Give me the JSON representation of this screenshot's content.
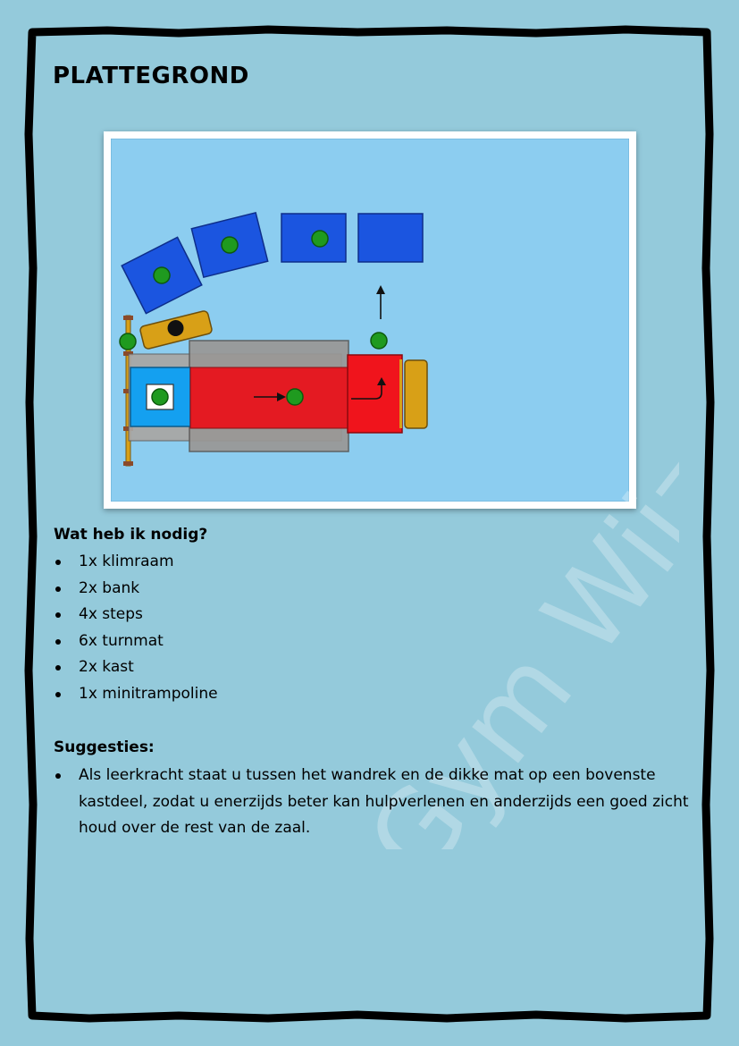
{
  "page": {
    "title": "PLATTEGROND",
    "watermark": "Gym Wijzer ©"
  },
  "needs": {
    "heading": "Wat heb ik nodig?",
    "items": [
      "1x klimraam",
      "2x bank",
      "4x steps",
      "6x turnmat",
      "2x kast",
      "1x minitrampoline"
    ]
  },
  "suggestions": {
    "heading": "Suggesties:",
    "items": [
      "Als leerkracht staat u tussen het wandrek en de dikke mat op een bovenste kastdeel, zodat u enerzijds beter kan hulpverlenen en anderzijds een goed zicht houd over de rest van de zaal."
    ]
  },
  "colors": {
    "page_bg": "#94cadb",
    "border": "#000000",
    "plan_bg": "#8ccdf0",
    "step": "#1b55e0",
    "mat": "#f0141c",
    "trampoline": "#14a0f0",
    "bench": "#d8a017",
    "marker": "#1f9a1f"
  }
}
